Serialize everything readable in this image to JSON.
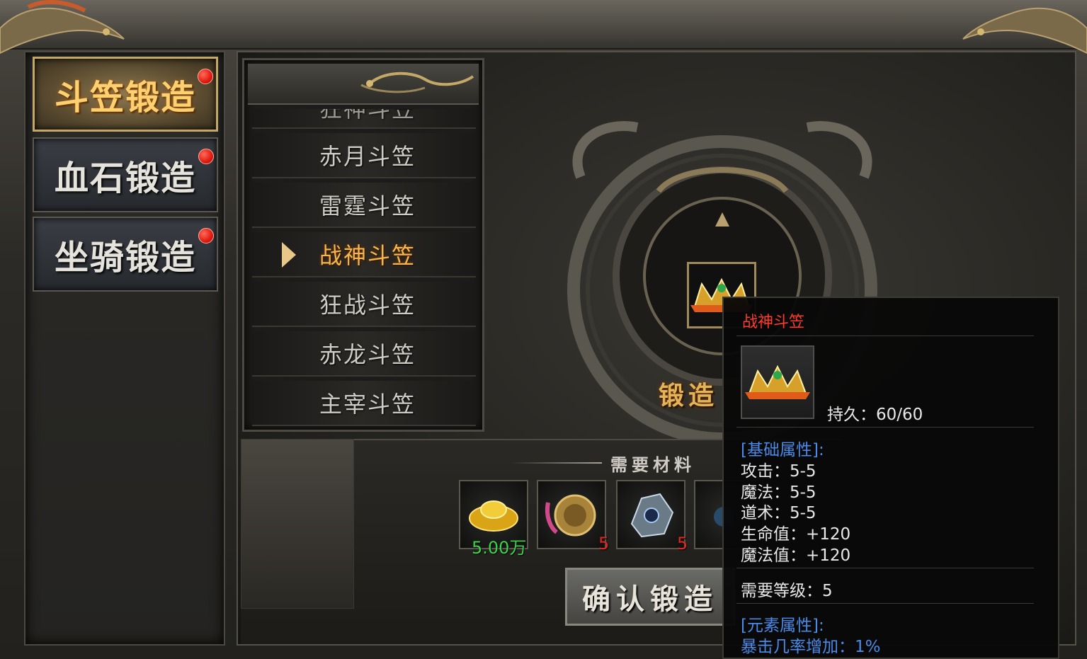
{
  "menu": [
    {
      "label": "斗笠锻造",
      "active": true
    },
    {
      "label": "血石锻造",
      "active": false
    },
    {
      "label": "坐骑锻造",
      "active": false
    }
  ],
  "item_list": {
    "items": [
      "赤月斗笠",
      "雷霆斗笠",
      "战神斗笠",
      "狂战斗笠",
      "赤龙斗笠",
      "主宰斗笠"
    ],
    "selected_index": 2
  },
  "forge": {
    "label": "锻造"
  },
  "materials": {
    "title": "需要材料",
    "slots": [
      {
        "icon": "gold-ingot-icon",
        "count": "5.00万",
        "count_color": "#3ed14a"
      },
      {
        "icon": "dragon-token-icon",
        "count": "5",
        "count_color": "#e0281e"
      },
      {
        "icon": "crystal-ore-icon",
        "count": "5",
        "count_color": "#e0281e"
      },
      {
        "icon": "material-icon",
        "count": "",
        "count_color": "#e0281e"
      }
    ],
    "confirm_label": "确认锻造"
  },
  "tooltip": {
    "name": "战神斗笠",
    "durability": "持久：60/60",
    "base_header": "[基础属性]:",
    "base_stats": [
      "攻击：5-5",
      "魔法：5-5",
      "道术：5-5",
      "生命值：+120",
      "魔法值：+120"
    ],
    "required_level": "需要等级：5",
    "element_header": "[元素属性]:",
    "element_stats": [
      "暴击几率增加：1%"
    ]
  },
  "colors": {
    "accent_gold": "#f5b650",
    "tooltip_title": "#ff3a2a",
    "tooltip_header": "#4a8ae8",
    "notify_dot": "#e01a10"
  }
}
